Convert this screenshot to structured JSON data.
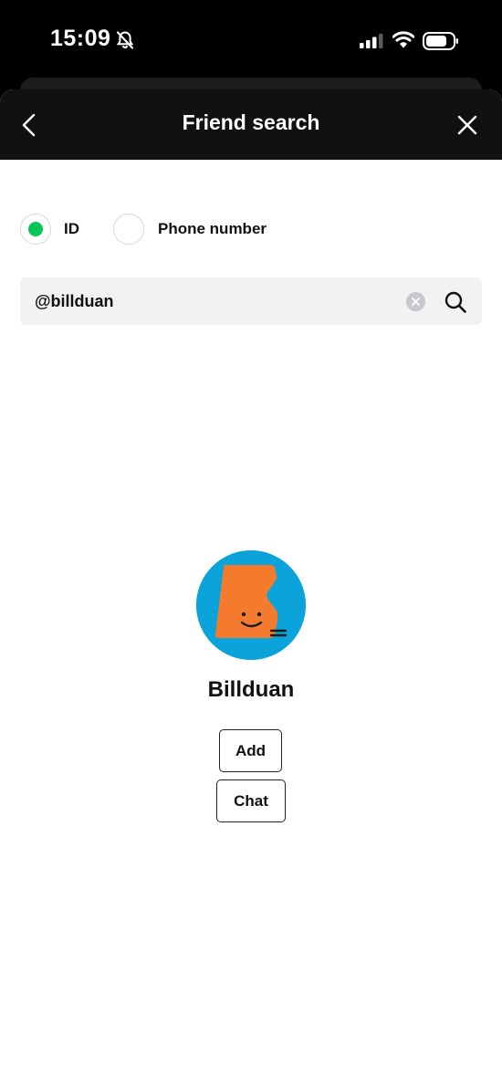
{
  "status_bar": {
    "time": "15:09"
  },
  "header": {
    "title": "Friend search"
  },
  "search_type": {
    "options": [
      {
        "label": "ID",
        "selected": true
      },
      {
        "label": "Phone number",
        "selected": false
      }
    ]
  },
  "search": {
    "value": "@billduan"
  },
  "result": {
    "name": "Billduan"
  },
  "actions": {
    "add_label": "Add",
    "chat_label": "Chat"
  },
  "colors": {
    "accent": "#06c755",
    "avatar_bg": "#0aa4db",
    "avatar_figure": "#f47a2d"
  },
  "icons": [
    "bell-slash-icon",
    "signal-icon",
    "wifi-icon",
    "battery-icon",
    "chevron-left-icon",
    "close-icon",
    "clear-icon",
    "search-icon"
  ]
}
